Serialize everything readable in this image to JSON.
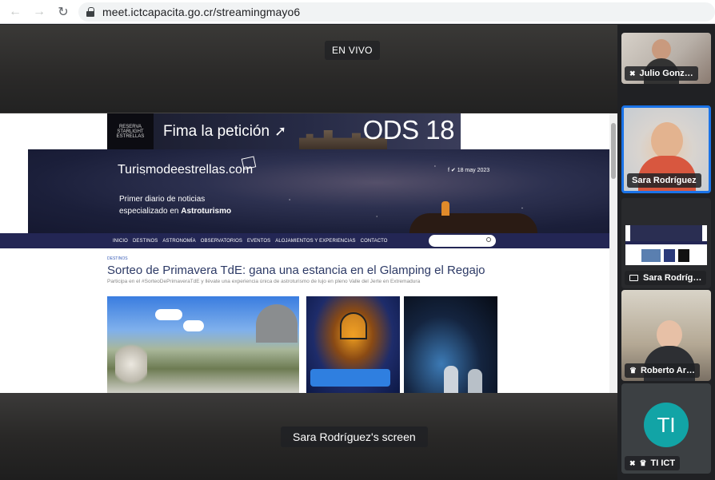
{
  "browser": {
    "url": "meet.ictcapacita.go.cr/streamingmayo6"
  },
  "stage": {
    "live_badge": "EN VIVO",
    "screen_label": "Sara Rodríguez's screen"
  },
  "shared_page": {
    "ad": {
      "logo_text": "RESERVA STARLIGHT ESTRELLAS",
      "petition": "Fima la petición",
      "ods": "ODS 18"
    },
    "hero": {
      "title": "Turismodeestrellas.com",
      "date": "f  ✔  18 may 2023",
      "tagline_1": "Primer diario de noticias",
      "tagline_2_prefix": "especializado en ",
      "tagline_2_bold": "Astroturismo"
    },
    "nav": [
      "INICIO",
      "DESTINOS",
      "ASTRONOMÍA",
      "OBSERVATORIOS",
      "EVENTOS",
      "ALOJAMIENTOS Y EXPERIENCIAS",
      "CONTACTO"
    ],
    "article": {
      "category": "DESTINOS",
      "title": "Sorteo de Primavera TdE: gana una estancia en el Glamping el Regajo",
      "subtitle": "Participa en el #SorteoDePrimaveraTdE y llévate una experiencia única de astroturismo de lujo en pleno Valle del Jerte en Extremadura"
    }
  },
  "participants": [
    {
      "name": "Julio Gonz…",
      "muted": true
    },
    {
      "name": "Sara Rodríguez",
      "active": true
    },
    {
      "name": "Sara Rodríg…",
      "presenting": true
    },
    {
      "name": "Roberto Ar…",
      "host": true
    },
    {
      "name": "TI ICT",
      "initials": "TI",
      "muted": true,
      "host": true
    }
  ],
  "colors": {
    "active_speaker": "#1a73e8",
    "avatar": "#12a4a6",
    "site_nav": "#232654"
  }
}
